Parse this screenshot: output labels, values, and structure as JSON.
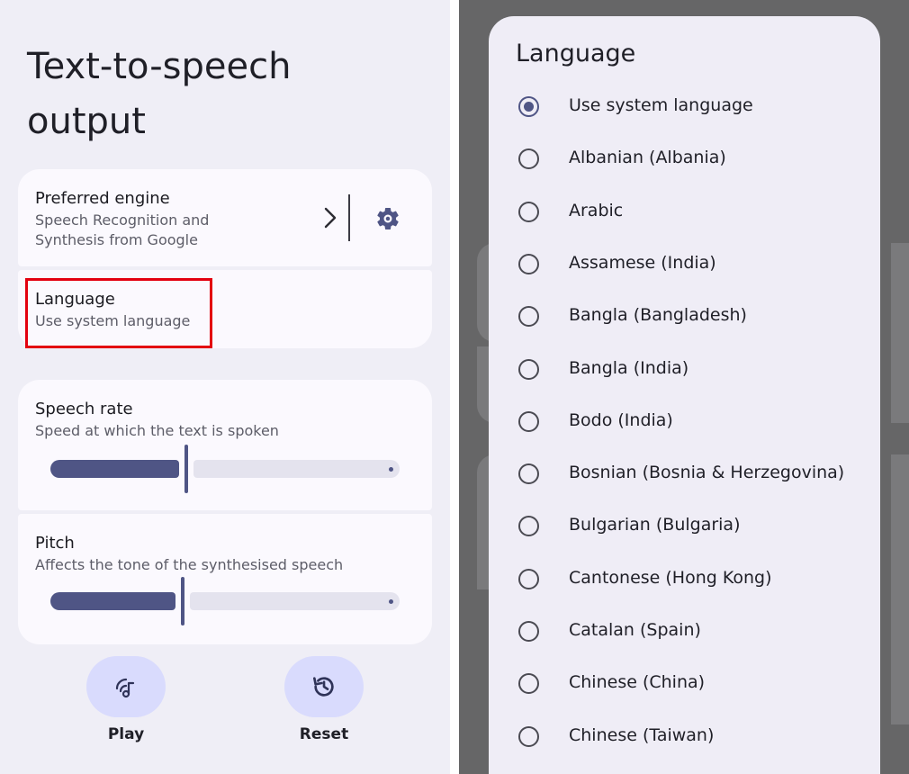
{
  "left": {
    "page_title_line1": "Text-to-speech",
    "page_title_line2": "output",
    "engine": {
      "title": "Preferred engine",
      "subtitle_line1": "Speech Recognition and",
      "subtitle_line2": "Synthesis from Google",
      "icon": "chevron-right-icon",
      "settings_icon": "gear-icon"
    },
    "language": {
      "title": "Language",
      "subtitle": "Use system language"
    },
    "speech_rate": {
      "title": "Speech rate",
      "subtitle": "Speed at which the text is spoken",
      "value": 0.39
    },
    "pitch": {
      "title": "Pitch",
      "subtitle": "Affects the tone of the synthesised speech",
      "value": 0.38
    },
    "play_label": "Play",
    "reset_label": "Reset"
  },
  "dialog": {
    "title": "Language",
    "selected_index": 0,
    "options": [
      "Use system language",
      "Albanian (Albania)",
      "Arabic",
      "Assamese (India)",
      "Bangla (Bangladesh)",
      "Bangla (India)",
      "Bodo (India)",
      "Bosnian (Bosnia & Herzegovina)",
      "Bulgarian (Bulgaria)",
      "Cantonese (Hong Kong)",
      "Catalan (Spain)",
      "Chinese (China)",
      "Chinese (Taiwan)"
    ]
  },
  "colors": {
    "accent": "#4f5585",
    "highlight": "#e3000f",
    "fab": "#d9dbfd",
    "scrim": "#666667"
  }
}
